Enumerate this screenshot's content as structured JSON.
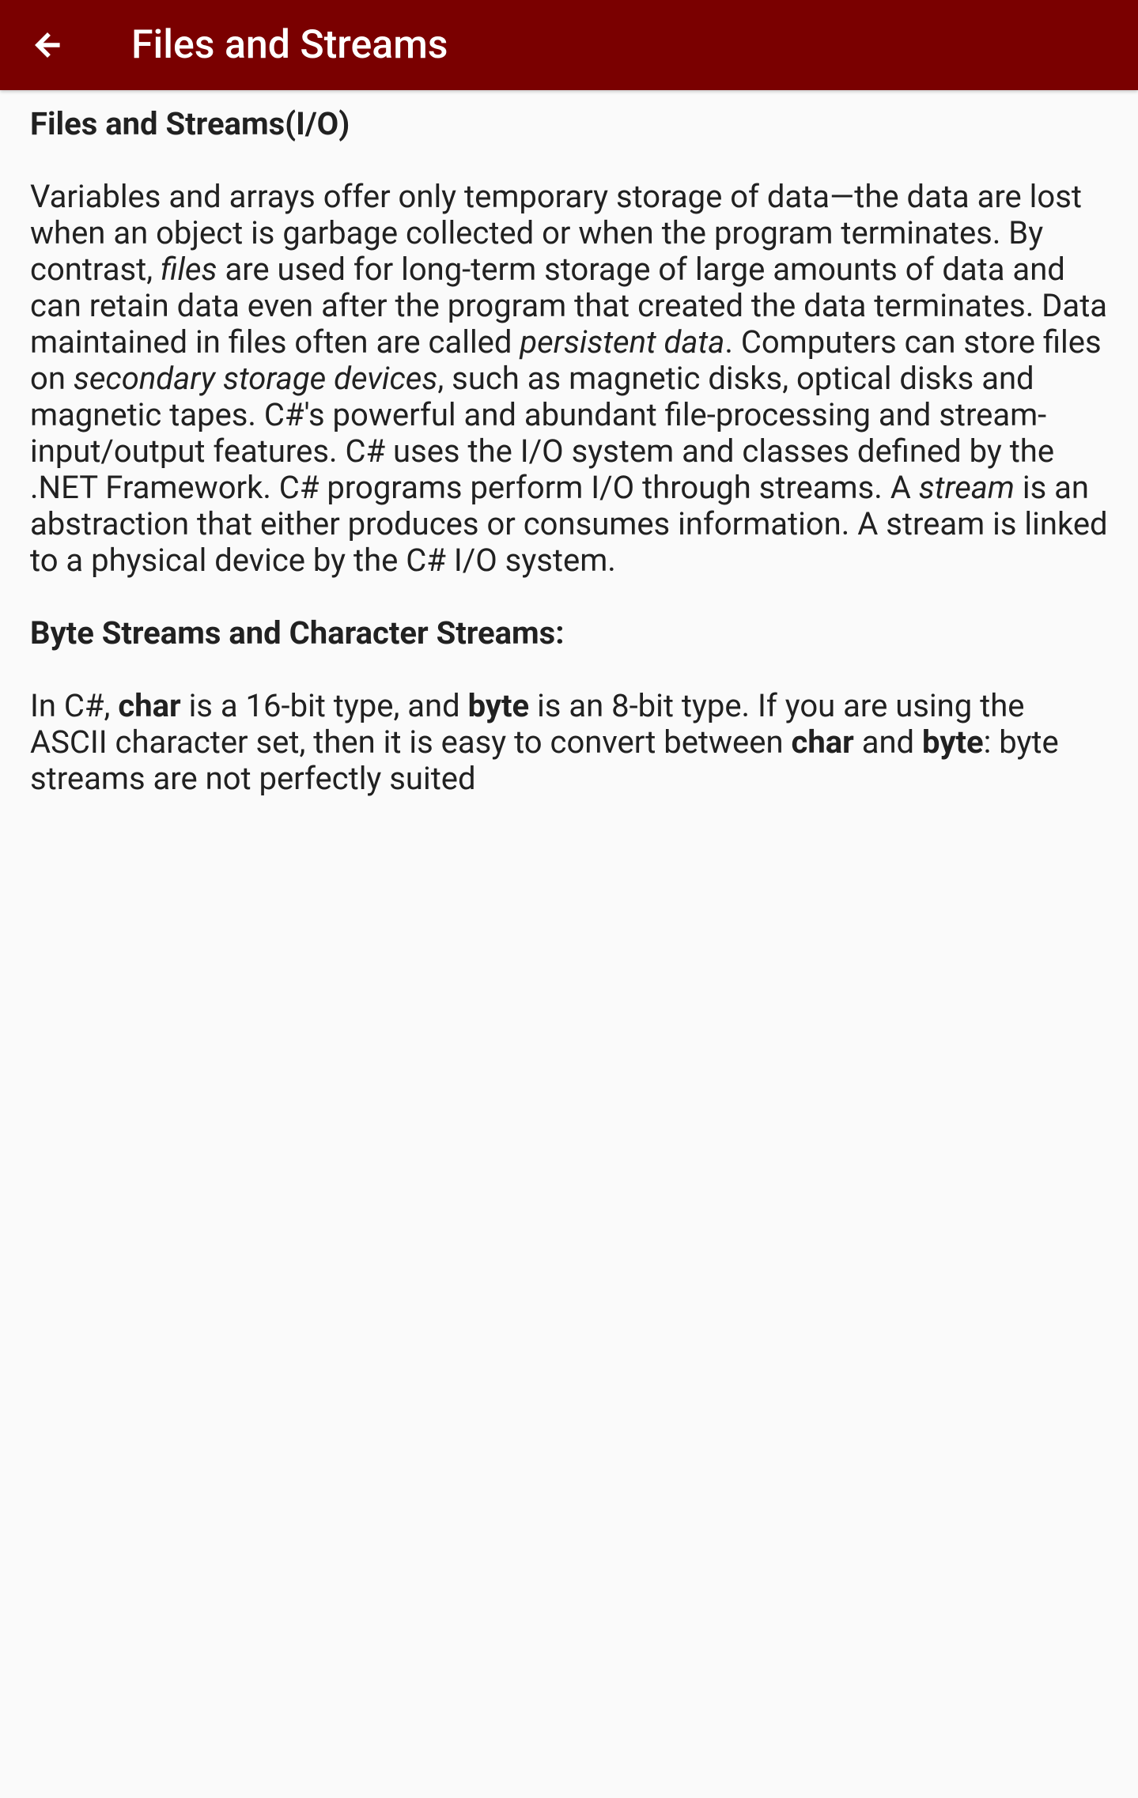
{
  "header": {
    "title": "Files and Streams"
  },
  "content": {
    "section_heading": "Files and Streams(I/O)",
    "para1_part1": "Variables and arrays offer only temporary storage of data—the data are lost when an object is garbage collected or when the program terminates. By contrast, ",
    "para1_italic1": "files",
    "para1_part2": " are used for long-term storage of large amounts of data and can retain data even after the program that created the data terminates. Data maintained in files often are called ",
    "para1_italic2": "persistent data",
    "para1_part3": ". Computers can store files on ",
    "para1_italic3": "secondary storage devices",
    "para1_part4": ", such as magnetic disks, optical disks and magnetic tapes. C#'s powerful and abundant file-processing and stream-input/output features. C# uses the I/O system and classes defined by the .NET Framework. C# programs perform I/O through streams. A ",
    "para1_italic4": "stream",
    "para1_part5": " is an abstraction that either produces or consumes information. A stream is linked to a physical device by the C# I/O system.",
    "subheading": "Byte Streams and Character Streams:",
    "para2_part1": "In C#, ",
    "para2_bold1": "char",
    "para2_part2": " is a 16-bit type, and ",
    "para2_bold2": "byte",
    "para2_part3": " is an 8-bit type. If you are using the ASCII character set, then it is easy to convert between ",
    "para2_bold3": "char",
    "para2_part4": " and ",
    "para2_bold4": "byte",
    "para2_part5": ": byte streams are not perfectly suited"
  }
}
